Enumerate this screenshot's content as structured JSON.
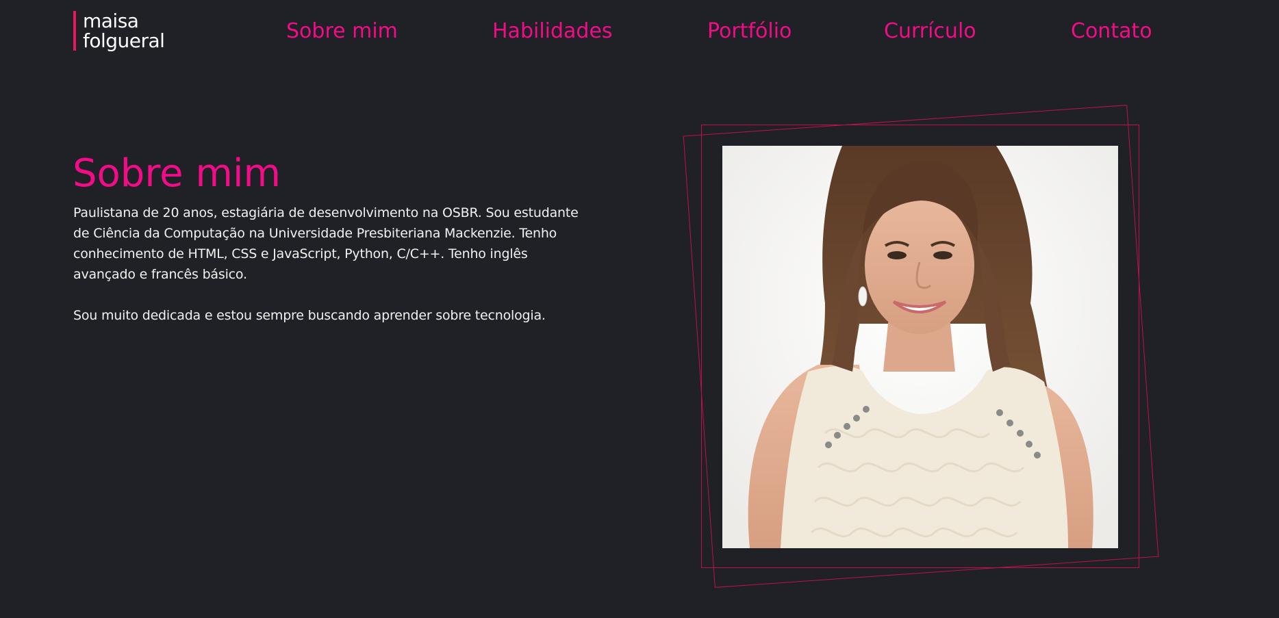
{
  "logo": {
    "line1": "maisa",
    "line2": "folgueral"
  },
  "nav": {
    "items": [
      {
        "label": "Sobre mim"
      },
      {
        "label": "Habilidades"
      },
      {
        "label": "Portfólio"
      },
      {
        "label": "Currículo"
      },
      {
        "label": "Contato"
      }
    ]
  },
  "about": {
    "title": "Sobre mim",
    "paragraph1": "Paulistana de 20 anos, estagiária de desenvolvimento na OSBR. Sou estudante de Ciência da Computação na Universidade Presbiteriana Mackenzie. Tenho conhecimento de HTML, CSS e JavaScript, Python, C/C++. Tenho inglês avançado e francês básico.",
    "paragraph2": "Sou muito dedicada e estou sempre buscando aprender sobre tecnologia."
  },
  "colors": {
    "background": "#202126",
    "accent": "#f20c87",
    "frame": "#c0114d",
    "text": "#f2f2f2"
  }
}
